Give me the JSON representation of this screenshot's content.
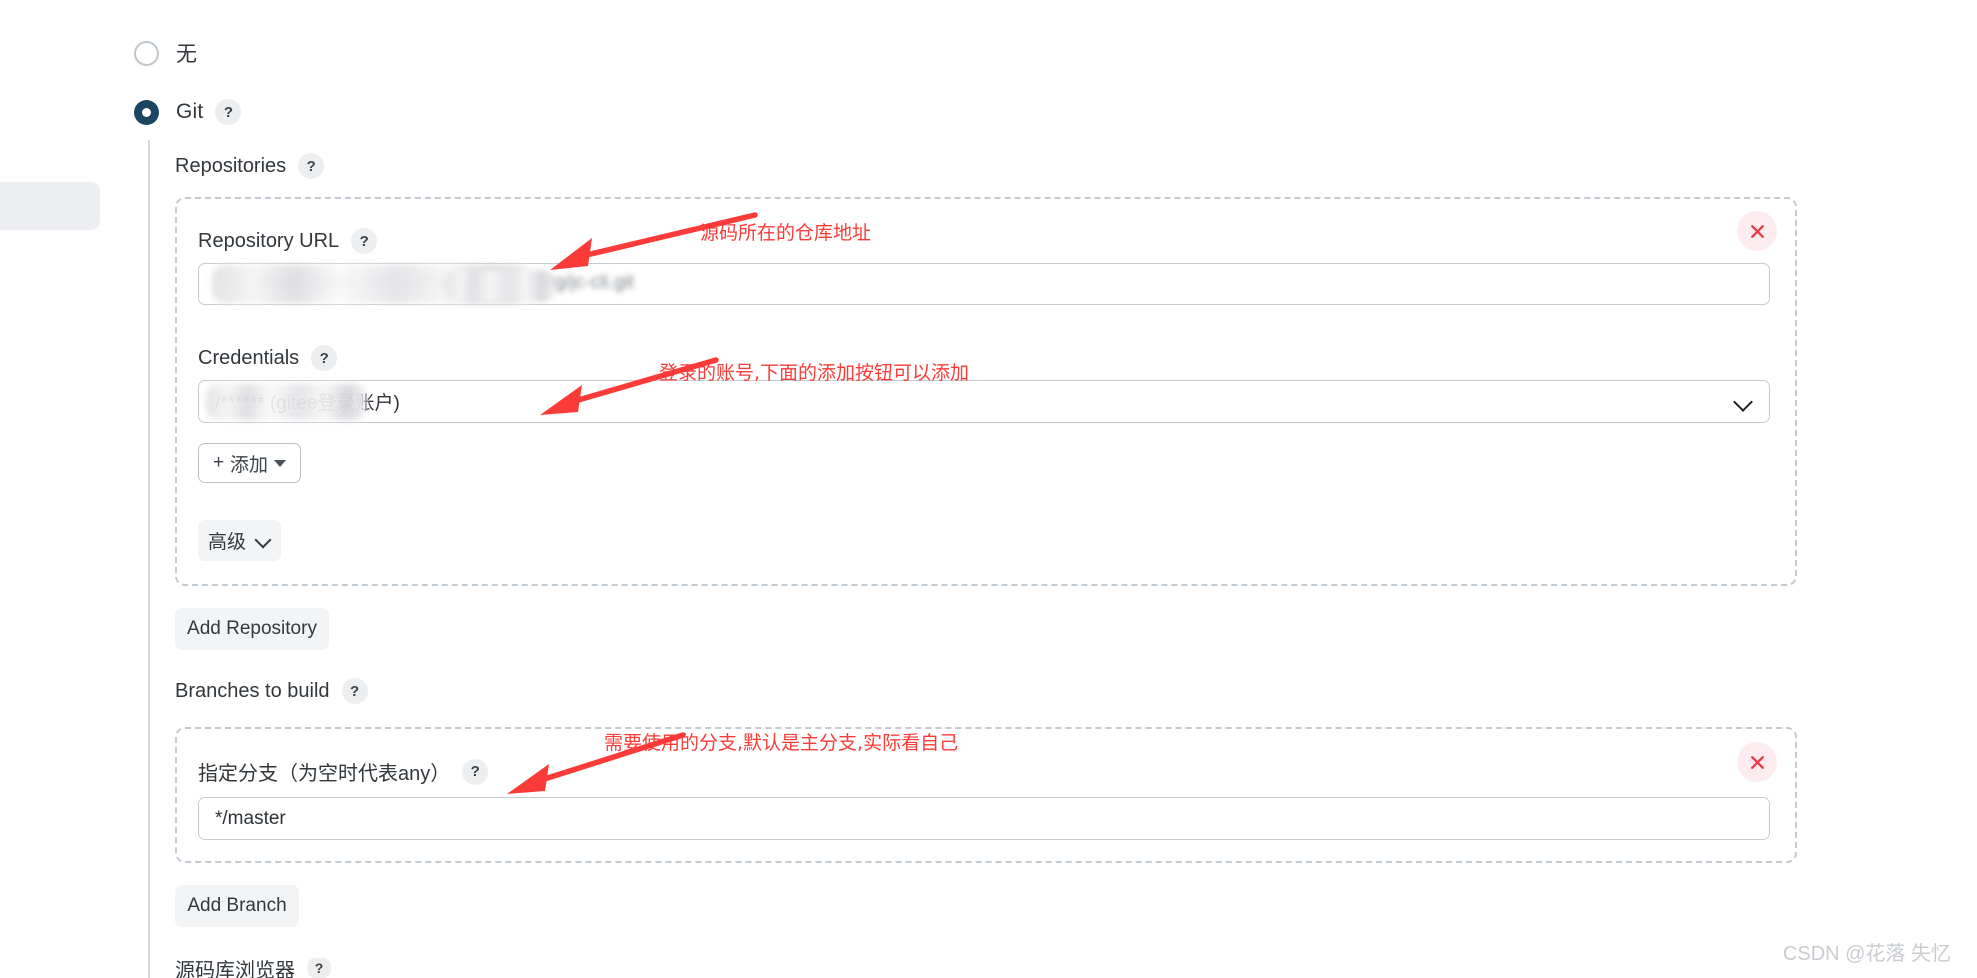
{
  "scm": {
    "options": [
      {
        "id": "none",
        "label": "无",
        "selected": false
      },
      {
        "id": "git",
        "label": "Git",
        "selected": true,
        "help": "?"
      }
    ]
  },
  "repositories": {
    "section_label": "Repositories",
    "help": "?",
    "repository_url": {
      "label": "Repository URL",
      "help": "?",
      "value": "",
      "redacted": true
    },
    "credentials": {
      "label": "Credentials",
      "help": "?",
      "selected_value": "/****** (gitee登录账户)",
      "redacted_prefix": true,
      "add_button": "添加",
      "add_button_prefix": "+"
    },
    "advanced_button": "高级",
    "remove_button_icon": "close-icon",
    "add_repository_button": "Add Repository"
  },
  "branches": {
    "section_label": "Branches to build",
    "help": "?",
    "branch_specifier": {
      "label": "指定分支（为空时代表any）",
      "help": "?",
      "value": "*/master"
    },
    "remove_button_icon": "close-icon",
    "add_branch_button": "Add Branch"
  },
  "repository_browser": {
    "label": "源码库浏览器",
    "help": "?"
  },
  "annotations": [
    {
      "id": "url-note",
      "text": "源码所在的仓库地址"
    },
    {
      "id": "cred-note",
      "text": "登录的账号,下面的添加按钮可以添加"
    },
    {
      "id": "branch-note",
      "text": "需要使用的分支,默认是主分支,实际看自己"
    }
  ],
  "watermark": "CSDN @花落 失忆",
  "colors": {
    "accent": "#1b4560",
    "annotation_red": "#fb3b37",
    "remove_red": "#e8394a",
    "dashed_border": "#c3cbd2",
    "input_border": "#c3ccd1"
  }
}
